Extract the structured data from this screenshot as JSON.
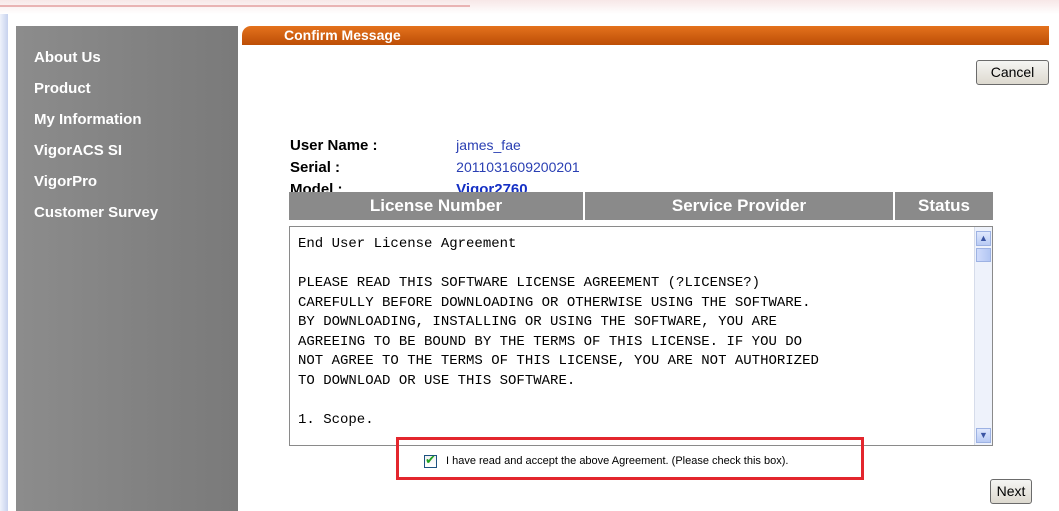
{
  "sidebar": {
    "items": [
      {
        "label": "About Us"
      },
      {
        "label": "Product"
      },
      {
        "label": "My Information"
      },
      {
        "label": "VigorACS SI"
      },
      {
        "label": "VigorPro"
      },
      {
        "label": "Customer Survey"
      }
    ]
  },
  "header": {
    "title": "Confirm Message"
  },
  "buttons": {
    "cancel": "Cancel",
    "next": "Next"
  },
  "info": {
    "user_name": {
      "label": "User Name :",
      "value": "james_fae"
    },
    "serial": {
      "label": "Serial :",
      "value": "2011031609200201"
    },
    "model": {
      "label": "Model :",
      "value": "Vigor2760"
    }
  },
  "table": {
    "columns": [
      {
        "label": "License Number"
      },
      {
        "label": "Service Provider"
      },
      {
        "label": "Status"
      }
    ]
  },
  "license": {
    "text": "End User License Agreement\n\nPLEASE READ THIS SOFTWARE LICENSE AGREEMENT (?LICENSE?)\nCAREFULLY BEFORE DOWNLOADING OR OTHERWISE USING THE SOFTWARE.\nBY DOWNLOADING, INSTALLING OR USING THE SOFTWARE, YOU ARE\nAGREEING TO BE BOUND BY THE TERMS OF THIS LICENSE. IF YOU DO\nNOT AGREE TO THE TERMS OF THIS LICENSE, YOU ARE NOT AUTHORIZED\nTO DOWNLOAD OR USE THIS SOFTWARE.\n\n1. Scope."
  },
  "agreement": {
    "label": "I have read and accept the above Agreement. (Please check this box).",
    "checked": true
  },
  "colors": {
    "header_orange": "#d35f10",
    "sidebar_gray": "#848484",
    "value_blue": "#2a3fb3",
    "highlight_red": "#e3262d"
  }
}
